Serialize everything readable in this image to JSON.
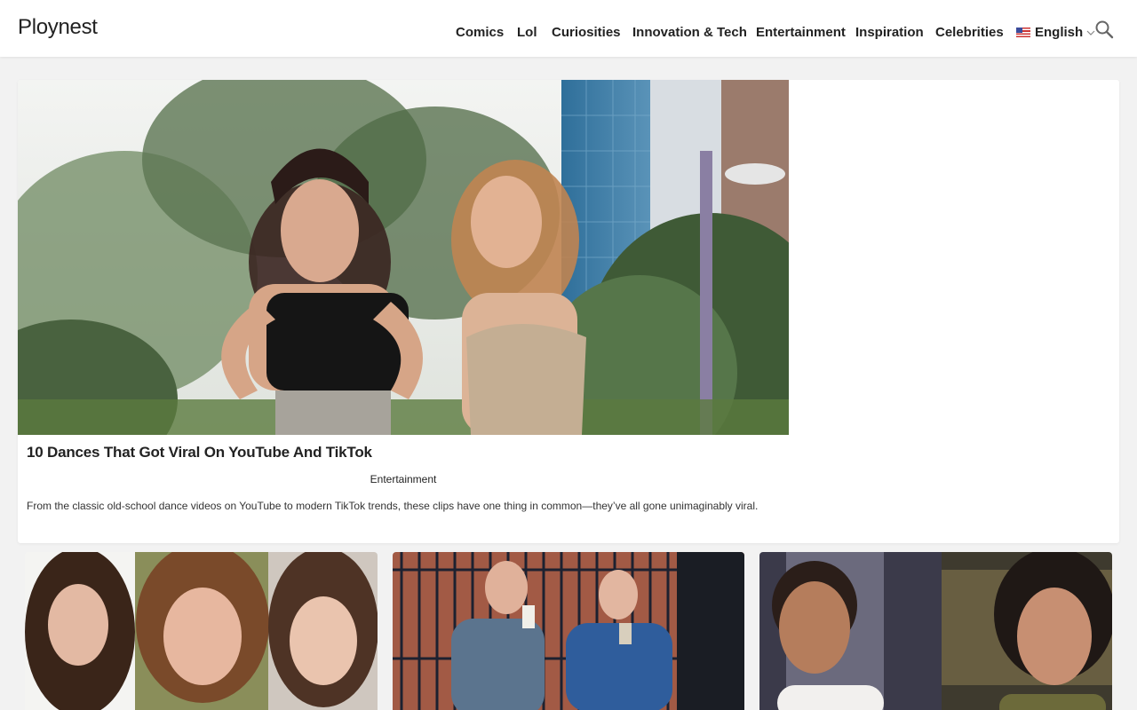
{
  "site": {
    "logo": "Ploynest"
  },
  "nav": {
    "items": [
      "Comics",
      "Lol",
      "Curiosities",
      "Innovation & Tech",
      "Entertainment",
      "Inspiration",
      "Celebrities"
    ],
    "language": "English"
  },
  "featured": {
    "title": "10 Dances That Got Viral On YouTube And TikTok",
    "category": "Entertainment",
    "excerpt": "From the classic old-school dance videos on YouTube to modern TikTok trends, these clips have one thing in common—they’ve all gone unimaginably viral."
  },
  "icons": {
    "search": "search-icon",
    "language_chevron": "chevron-down-icon",
    "flag": "us-flag-icon"
  }
}
